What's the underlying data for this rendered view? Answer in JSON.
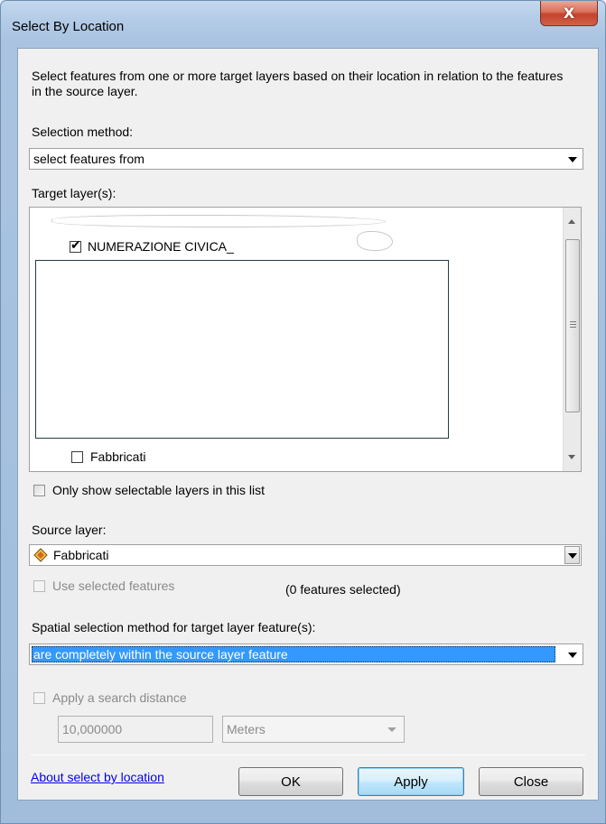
{
  "window": {
    "title": "Select By Location",
    "close_glyph": "X"
  },
  "description": "Select features from one or more target layers based on their location in relation to the features in the source layer.",
  "selection_method": {
    "label": "Selection method:",
    "value": "select features from"
  },
  "target_layers": {
    "label": "Target layer(s):",
    "items": [
      {
        "label": "NUMERAZIONE CIVICA_",
        "checked": true
      },
      {
        "label": "Fabbricati",
        "checked": false
      }
    ]
  },
  "only_selectable": {
    "label": "Only show selectable layers in this list",
    "checked": false
  },
  "source_layer": {
    "label": "Source layer:",
    "value": "Fabbricati",
    "icon": "polygon-layer-icon"
  },
  "use_selected": {
    "label": "Use selected features",
    "count_text": "(0 features selected)",
    "enabled": false
  },
  "spatial_method": {
    "label": "Spatial selection method for target layer feature(s):",
    "value": "are completely within the source layer feature"
  },
  "search_distance": {
    "label": "Apply a search distance",
    "value": "10,000000",
    "unit": "Meters",
    "enabled": false
  },
  "about_link": "About select by location",
  "buttons": {
    "ok": "OK",
    "apply": "Apply",
    "close": "Close"
  },
  "colors": {
    "selection_highlight": "#3399ff",
    "link": "#0000ee",
    "close_button": "#c4432c"
  }
}
